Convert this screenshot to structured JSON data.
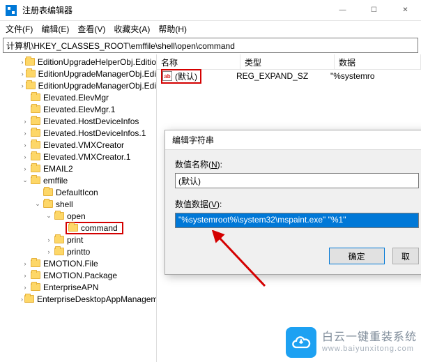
{
  "window": {
    "title": "注册表编辑器",
    "min": "—",
    "max": "☐",
    "close": "✕"
  },
  "menus": {
    "file": "文件(F)",
    "edit": "编辑(E)",
    "view": "查看(V)",
    "fav": "收藏夹(A)",
    "help": "帮助(H)"
  },
  "address": "计算机\\HKEY_CLASSES_ROOT\\emffile\\shell\\open\\command",
  "tree": [
    {
      "indent": 30,
      "tw": ">",
      "label": "EditionUpgradeHelperObj.Editio"
    },
    {
      "indent": 30,
      "tw": ">",
      "label": "EditionUpgradeManagerObj.Edi"
    },
    {
      "indent": 30,
      "tw": ">",
      "label": "EditionUpgradeManagerObj.Edi"
    },
    {
      "indent": 30,
      "tw": "",
      "label": "Elevated.ElevMgr"
    },
    {
      "indent": 30,
      "tw": "",
      "label": "Elevated.ElevMgr.1"
    },
    {
      "indent": 30,
      "tw": ">",
      "label": "Elevated.HostDeviceInfos"
    },
    {
      "indent": 30,
      "tw": ">",
      "label": "Elevated.HostDeviceInfos.1"
    },
    {
      "indent": 30,
      "tw": ">",
      "label": "Elevated.VMXCreator"
    },
    {
      "indent": 30,
      "tw": ">",
      "label": "Elevated.VMXCreator.1"
    },
    {
      "indent": 30,
      "tw": ">",
      "label": "EMAIL2"
    },
    {
      "indent": 30,
      "tw": "v",
      "label": "emffile"
    },
    {
      "indent": 48,
      "tw": "",
      "label": "DefaultIcon"
    },
    {
      "indent": 48,
      "tw": "v",
      "label": "shell"
    },
    {
      "indent": 64,
      "tw": "v",
      "label": "open"
    },
    {
      "indent": 80,
      "tw": "",
      "label": "command",
      "selected": true
    },
    {
      "indent": 64,
      "tw": ">",
      "label": "print"
    },
    {
      "indent": 64,
      "tw": ">",
      "label": "printto"
    },
    {
      "indent": 30,
      "tw": ">",
      "label": "EMOTION.File"
    },
    {
      "indent": 30,
      "tw": ">",
      "label": "EMOTION.Package"
    },
    {
      "indent": 30,
      "tw": ">",
      "label": "EnterpriseAPN"
    },
    {
      "indent": 30,
      "tw": ">",
      "label": "EnterpriseDesktopAppManagem"
    }
  ],
  "list": {
    "headers": {
      "name": "名称",
      "type": "类型",
      "data": "数据"
    },
    "row": {
      "icon": "ab",
      "name": "(默认)",
      "type": "REG_EXPAND_SZ",
      "data": "\"%systemro"
    }
  },
  "dialog": {
    "title": "编辑字符串",
    "name_label_pre": "数值名称(",
    "name_label_hk": "N",
    "name_label_post": "):",
    "name_value": "(默认)",
    "data_label_pre": "数值数据(",
    "data_label_hk": "V",
    "data_label_post": "):",
    "data_value": "\"%systemroot%\\system32\\mspaint.exe\" \"%1\"",
    "ok": "确定",
    "cancel": "取"
  },
  "watermark": {
    "cn": "白云一键重装系统",
    "en": "www.baiyunxitong.com"
  }
}
